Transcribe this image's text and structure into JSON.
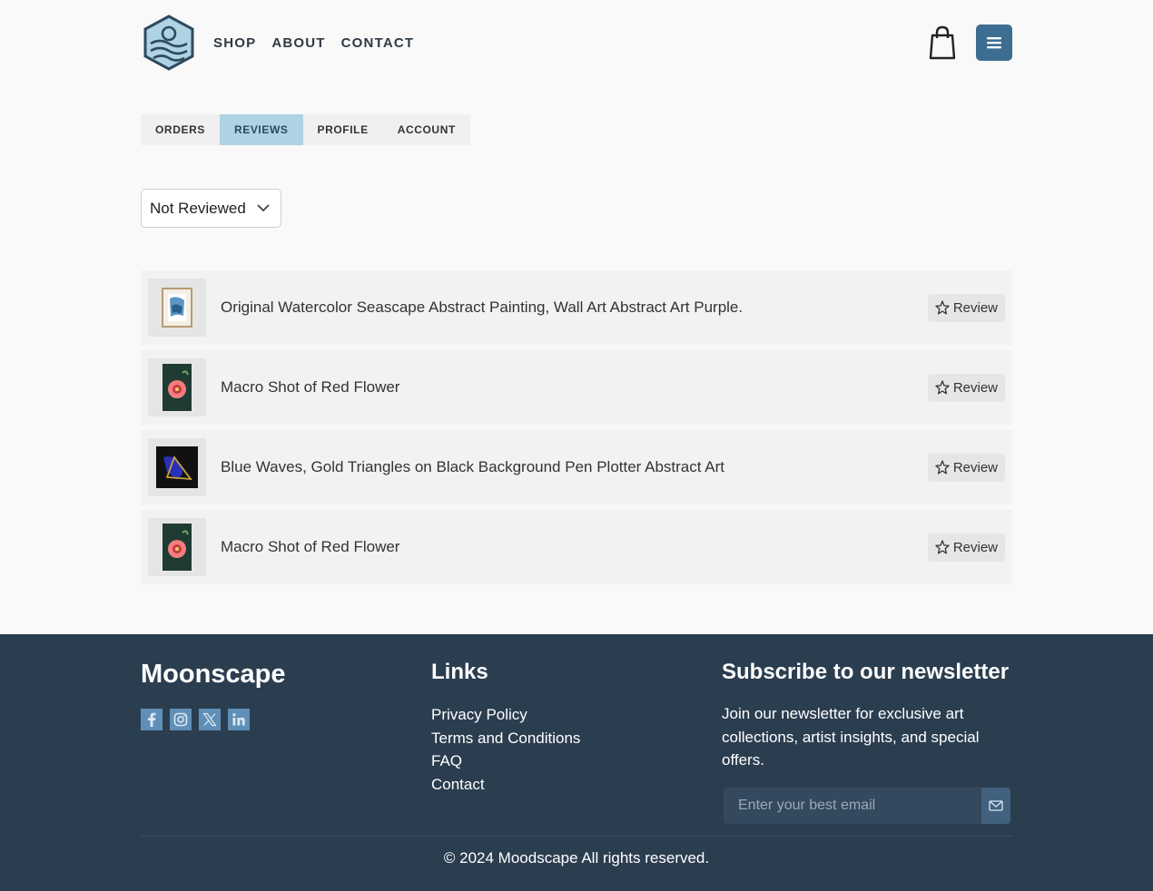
{
  "header": {
    "logo": "moonscape-logo-icon",
    "nav": [
      "SHOP",
      "ABOUT",
      "CONTACT"
    ],
    "cart_icon": "shopping-bag-icon",
    "menu_icon": "hamburger-menu-icon"
  },
  "tabs": [
    {
      "label": "ORDERS",
      "active": false
    },
    {
      "label": "REVIEWS",
      "active": true
    },
    {
      "label": "PROFILE",
      "active": false
    },
    {
      "label": "ACCOUNT",
      "active": false
    }
  ],
  "filter": {
    "selected": "Not Reviewed"
  },
  "items": [
    {
      "title": "Original Watercolor Seascape Abstract Painting, Wall Art Abstract Art Purple.",
      "button": "Review"
    },
    {
      "title": "Macro Shot of Red Flower",
      "button": "Review"
    },
    {
      "title": "Blue Waves, Gold Triangles on Black Background Pen Plotter Abstract Art",
      "button": "Review"
    },
    {
      "title": "Macro Shot of Red Flower",
      "button": "Review"
    }
  ],
  "footer": {
    "brand": "Moonscape",
    "socials": [
      "facebook-icon",
      "instagram-icon",
      "x-icon",
      "linkedin-icon"
    ],
    "links_title": "Links",
    "links": [
      "Privacy Policy",
      "Terms and Conditions",
      "FAQ",
      "Contact"
    ],
    "newsletter_title": "Subscribe to our newsletter",
    "newsletter_text": "Join our newsletter for exclusive art collections, artist insights, and special offers.",
    "email_placeholder": "Enter your best email",
    "copyright": "© 2024 Moodscape All rights reserved."
  },
  "colors": {
    "accent": "#3d6e91",
    "tab_active": "#aed3e3",
    "footer_bg": "#2b3e50",
    "social_bg": "#5f8fb6"
  }
}
